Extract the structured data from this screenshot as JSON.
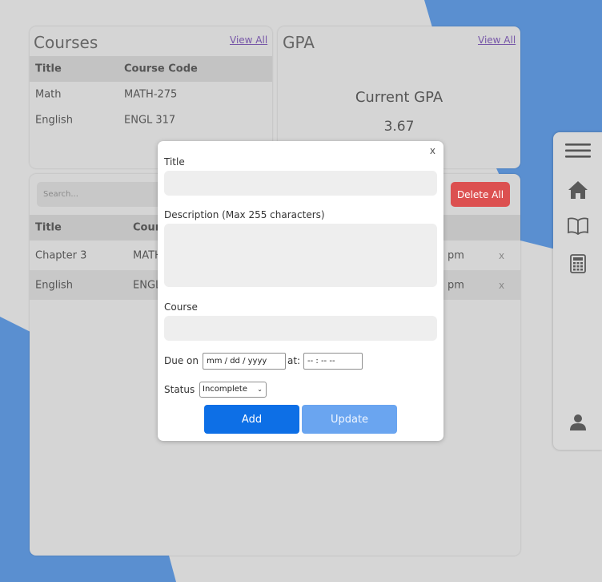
{
  "colors": {
    "background": "#d6d6d6",
    "accent_shape": "#5a8fd0",
    "delete_button": "#dc5050",
    "add_button": "#0d6fe6",
    "update_button": "#6aa5f0"
  },
  "courses": {
    "title": "Courses",
    "view_all": "View All",
    "columns": [
      "Title",
      "Course Code"
    ],
    "rows": [
      {
        "title": "Math",
        "code": "MATH-275"
      },
      {
        "title": "English",
        "code": "ENGL 317"
      }
    ]
  },
  "gpa": {
    "title": "GPA",
    "view_all": "View All",
    "label": "Current GPA",
    "value": "3.67"
  },
  "assignments": {
    "search_placeholder": "Search...",
    "delete_all": "Delete All",
    "columns": [
      "Title",
      "Cour"
    ],
    "rows": [
      {
        "title": "Chapter 3",
        "course": "MATH",
        "time": "pm",
        "remove": "x"
      },
      {
        "title": "English",
        "course": "ENGL",
        "time": "pm",
        "remove": "x"
      }
    ]
  },
  "sidebar": {
    "icons": [
      "menu-icon",
      "home-icon",
      "book-icon",
      "calculator-icon",
      "user-icon"
    ]
  },
  "modal": {
    "close": "x",
    "title_label": "Title",
    "description_label": "Description (Max 255 characters)",
    "course_label": "Course",
    "due_label": "Due on",
    "date_placeholder": "mm / dd / yyyy",
    "at_label": "at:",
    "time_placeholder": "-- : --   --",
    "status_label": "Status",
    "status_value": "Incomplete",
    "add_button": "Add",
    "update_button": "Update"
  }
}
